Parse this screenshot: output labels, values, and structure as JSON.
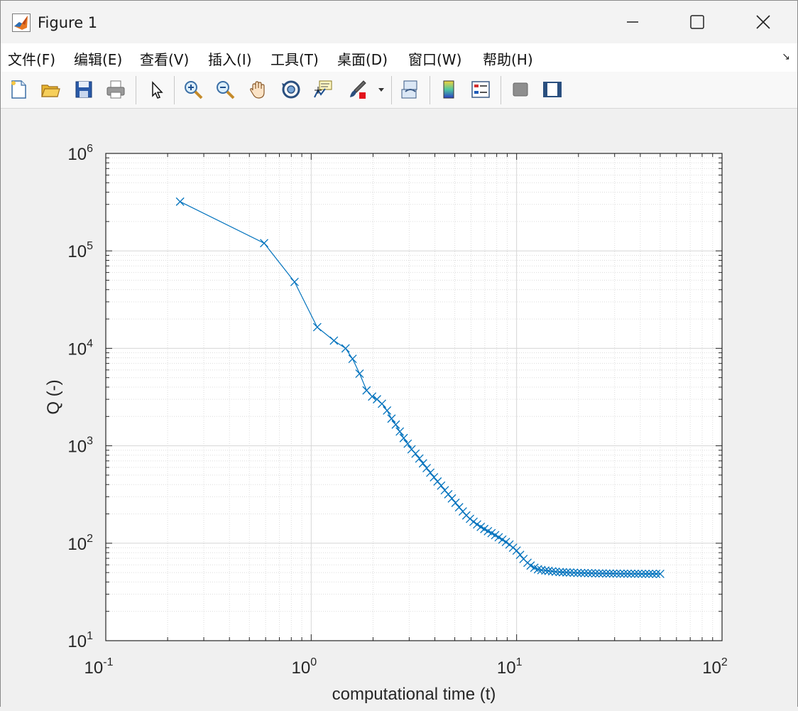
{
  "window": {
    "title": "Figure 1",
    "minimize_icon": "minimize-icon",
    "maximize_icon": "maximize-icon",
    "close_icon": "close-icon"
  },
  "menu": {
    "items": [
      "文件(F)",
      "编辑(E)",
      "查看(V)",
      "插入(I)",
      "工具(T)",
      "桌面(D)",
      "窗口(W)",
      "帮助(H)"
    ],
    "corner_icon": "dock-arrow-icon"
  },
  "toolbar": {
    "icons": [
      "new-figure-icon",
      "open-file-icon",
      "save-icon",
      "print-icon",
      "pointer-icon",
      "zoom-in-icon",
      "zoom-out-icon",
      "pan-hand-icon",
      "rotate-3d-icon",
      "data-cursor-icon",
      "brush-icon",
      "link-plot-icon",
      "colorbar-icon",
      "legend-icon",
      "hide-plot-tools-icon",
      "show-plot-tools-icon"
    ]
  },
  "chart_data": {
    "type": "line",
    "xscale": "log",
    "yscale": "log",
    "xlim": [
      0.1,
      100
    ],
    "ylim": [
      10,
      1000000
    ],
    "grid": true,
    "minor_grid": true,
    "marker": "x",
    "color": "#0072bd",
    "xlabel": "computational time (t)",
    "ylabel": "Q (-)",
    "xticks": [
      {
        "base": "10",
        "exp": "-1"
      },
      {
        "base": "10",
        "exp": "0"
      },
      {
        "base": "10",
        "exp": "1"
      },
      {
        "base": "10",
        "exp": "2"
      }
    ],
    "yticks": [
      {
        "base": "10",
        "exp": "1"
      },
      {
        "base": "10",
        "exp": "2"
      },
      {
        "base": "10",
        "exp": "3"
      },
      {
        "base": "10",
        "exp": "4"
      },
      {
        "base": "10",
        "exp": "5"
      },
      {
        "base": "10",
        "exp": "6"
      }
    ],
    "x": [
      0.23,
      0.59,
      0.83,
      1.07,
      1.29,
      1.47,
      1.59,
      1.72,
      1.86,
      1.98,
      2.09,
      2.21,
      2.34,
      2.46,
      2.58,
      2.7,
      2.82,
      2.95,
      3.08,
      3.22,
      3.36,
      3.5,
      3.65,
      3.8,
      3.96,
      4.12,
      4.29,
      4.47,
      4.65,
      4.84,
      5.04,
      5.25,
      5.47,
      5.69,
      5.93,
      6.17,
      6.42,
      6.69,
      6.96,
      7.25,
      7.55,
      7.86,
      8.18,
      8.52,
      8.87,
      9.23,
      9.61,
      10.0,
      10.4,
      10.8,
      11.3,
      11.7,
      12.2,
      12.7,
      13.2,
      13.8,
      14.3,
      14.9,
      15.5,
      16.2,
      16.8,
      17.5,
      18.2,
      19.0,
      19.8,
      20.6,
      21.4,
      22.3,
      23.2,
      24.2,
      25.2,
      26.2,
      27.3,
      28.4,
      29.5,
      30.7,
      32.0,
      33.3,
      34.7,
      36.1,
      37.6,
      39.1,
      40.7,
      42.4,
      44.1,
      45.9,
      47.8,
      50.0
    ],
    "y": [
      320000,
      120000,
      48000,
      16500,
      12000,
      10000,
      7800,
      5500,
      3700,
      3200,
      3000,
      2700,
      2300,
      1900,
      1650,
      1400,
      1200,
      1050,
      920,
      830,
      740,
      660,
      590,
      530,
      475,
      430,
      390,
      350,
      318,
      288,
      260,
      234,
      212,
      193,
      178,
      166,
      156,
      147,
      140,
      133,
      127,
      121,
      115,
      109,
      103,
      97,
      90,
      84,
      76,
      69,
      63,
      59,
      56,
      54,
      53,
      52.5,
      52,
      51.5,
      51,
      50.7,
      50.4,
      50.2,
      50,
      49.8,
      49.6,
      49.5,
      49.4,
      49.3,
      49.2,
      49.1,
      49,
      49,
      48.9,
      48.9,
      48.8,
      48.8,
      48.7,
      48.7,
      48.7,
      48.6,
      48.6,
      48.6,
      48.5,
      48.5,
      48.5,
      48.5,
      48.5,
      48.5
    ]
  }
}
